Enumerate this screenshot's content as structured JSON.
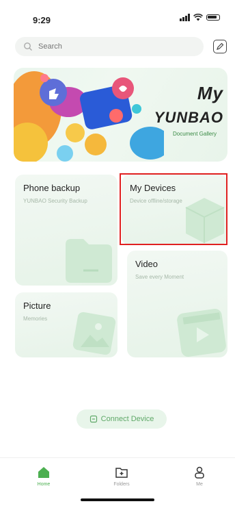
{
  "status_bar": {
    "time": "9:29"
  },
  "search": {
    "placeholder": "Search"
  },
  "banner": {
    "title": "My",
    "brand": "YUNBAO",
    "subtitle": "Document Gallery"
  },
  "cards": {
    "phone_backup": {
      "title": "Phone backup",
      "subtitle": "YUNBAO Security Backup"
    },
    "my_devices": {
      "title": "My Devices",
      "subtitle": "Device offline/storage"
    },
    "video": {
      "title": "Video",
      "subtitle": "Save every Moment"
    },
    "picture": {
      "title": "Picture",
      "subtitle": "Memories"
    }
  },
  "connect_button": {
    "label": "Connect Device"
  },
  "tabbar": {
    "items": [
      {
        "label": "Home",
        "icon": "home-icon",
        "active": true
      },
      {
        "label": "Folders",
        "icon": "folder-icon",
        "active": false
      },
      {
        "label": "Me",
        "icon": "person-icon",
        "active": false
      }
    ]
  },
  "colors": {
    "accent": "#4caf50",
    "highlight": "#e02020",
    "card_bg": "#eaf5ec"
  }
}
